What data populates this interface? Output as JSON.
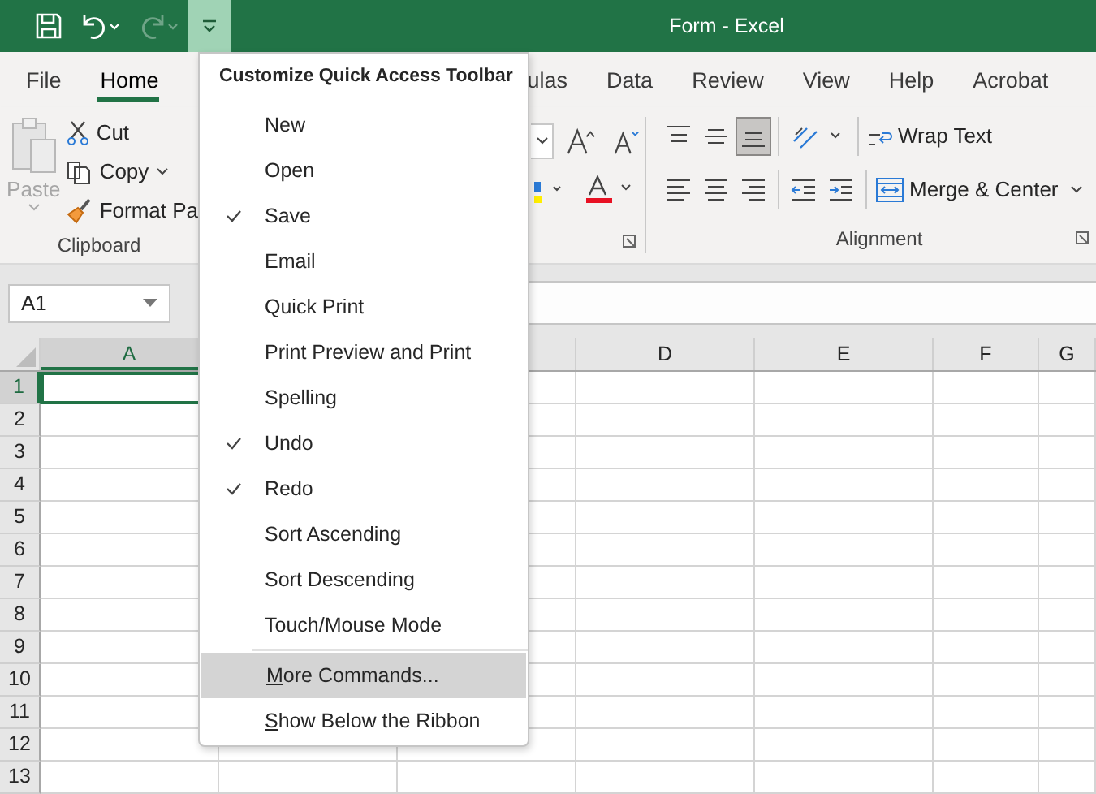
{
  "title_bar": {
    "title": "Form - Excel",
    "undo_enabled": true,
    "redo_enabled": false,
    "customize_open": true
  },
  "tabs": [
    {
      "label": "File",
      "selected": false
    },
    {
      "label": "Home",
      "selected": true
    },
    {
      "label": "ulas",
      "selected": false
    },
    {
      "label": "Data",
      "selected": false
    },
    {
      "label": "Review",
      "selected": false
    },
    {
      "label": "View",
      "selected": false
    },
    {
      "label": "Help",
      "selected": false
    },
    {
      "label": "Acrobat",
      "selected": false
    }
  ],
  "clipboard": {
    "paste": "Paste",
    "paste_enabled": false,
    "cut": "Cut",
    "copy": "Copy",
    "format_painter": "Format Pa",
    "label": "Clipboard"
  },
  "alignment": {
    "bottom_align_selected": true,
    "wrap_text": "Wrap Text",
    "merge": "Merge & Center",
    "label": "Alignment"
  },
  "name_box": {
    "value": "A1"
  },
  "columns": [
    {
      "label": "A",
      "selected": true
    },
    {
      "label": "D",
      "selected": false
    },
    {
      "label": "E",
      "selected": false
    },
    {
      "label": "F",
      "selected": false
    },
    {
      "label": "G",
      "selected": false
    }
  ],
  "rows": [
    {
      "label": "1",
      "selected": true
    },
    {
      "label": "2",
      "selected": false
    },
    {
      "label": "3",
      "selected": false
    },
    {
      "label": "4",
      "selected": false
    },
    {
      "label": "5",
      "selected": false
    },
    {
      "label": "6",
      "selected": false
    },
    {
      "label": "7",
      "selected": false
    },
    {
      "label": "8",
      "selected": false
    },
    {
      "label": "9",
      "selected": false
    },
    {
      "label": "10",
      "selected": false
    },
    {
      "label": "11",
      "selected": false
    },
    {
      "label": "12",
      "selected": false
    },
    {
      "label": "13",
      "selected": false
    }
  ],
  "menu": {
    "title": "Customize Quick Access Toolbar",
    "commands": [
      {
        "label": "New",
        "checked": false
      },
      {
        "label": "Open",
        "checked": false
      },
      {
        "label": "Save",
        "checked": true
      },
      {
        "label": "Email",
        "checked": false
      },
      {
        "label": "Quick Print",
        "checked": false
      },
      {
        "label": "Print Preview and Print",
        "checked": false
      },
      {
        "label": "Spelling",
        "checked": false
      },
      {
        "label": "Undo",
        "checked": true
      },
      {
        "label": "Redo",
        "checked": true
      },
      {
        "label": "Sort Ascending",
        "checked": false
      },
      {
        "label": "Sort Descending",
        "checked": false
      },
      {
        "label": "Touch/Mouse Mode",
        "checked": false
      }
    ],
    "actions": [
      {
        "label": "More Commands...",
        "selected": true,
        "access_key_first": true
      },
      {
        "label": "Show Below the Ribbon",
        "selected": false,
        "access_key_first": true
      }
    ]
  }
}
